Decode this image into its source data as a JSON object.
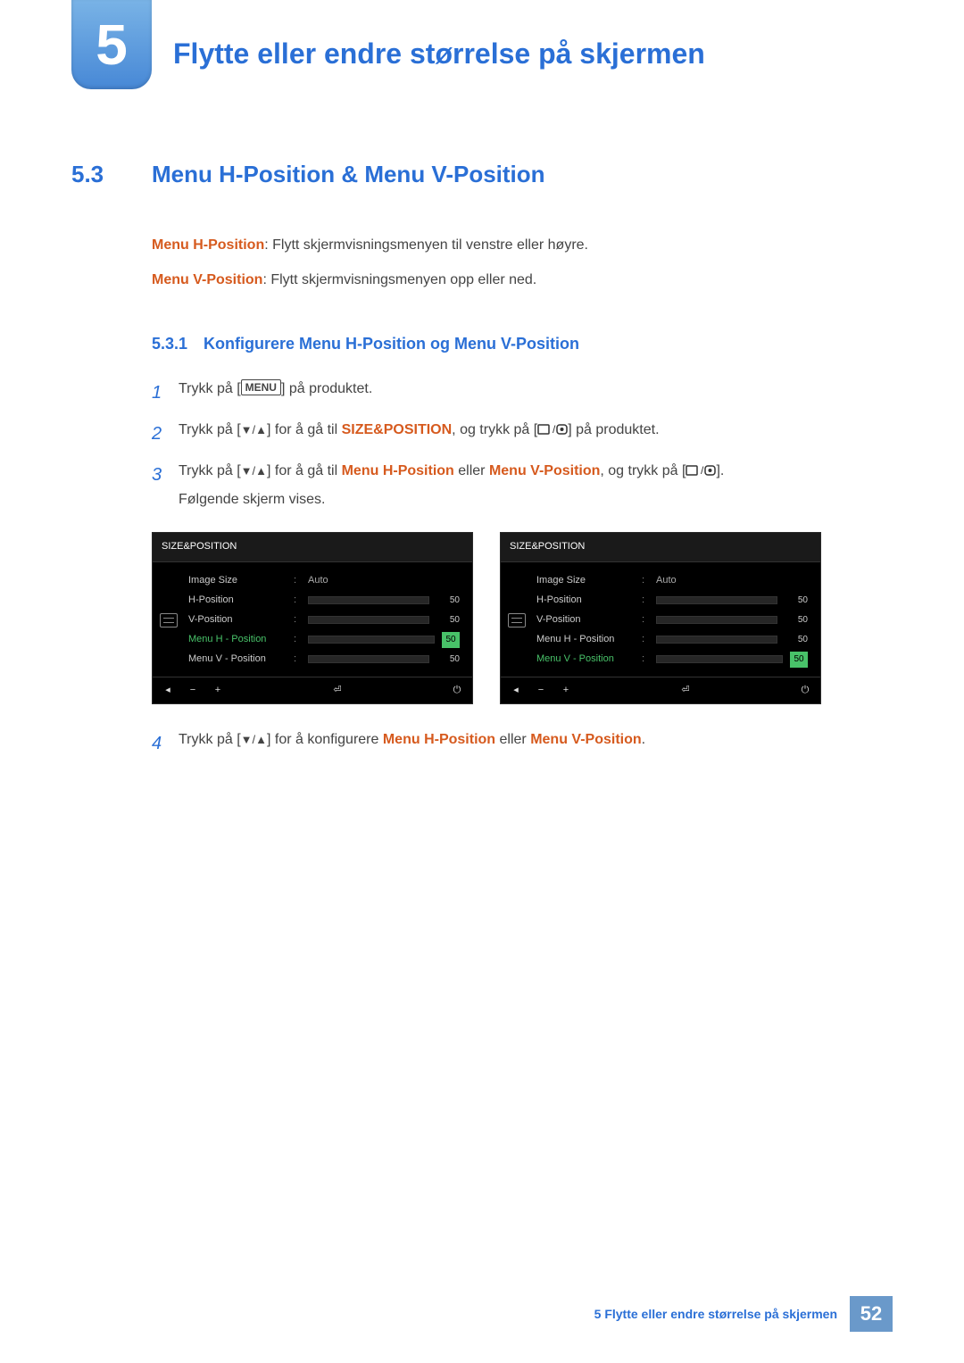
{
  "chapter": {
    "number": "5",
    "title": "Flytte eller endre størrelse på skjermen"
  },
  "section": {
    "number": "5.3",
    "title": "Menu H-Position & Menu V-Position"
  },
  "intro": {
    "hp_label": "Menu H-Position",
    "hp_text": ": Flytt skjermvisningsmenyen til venstre eller høyre.",
    "vp_label": "Menu V-Position",
    "vp_text": ": Flytt skjermvisningsmenyen opp eller ned."
  },
  "subsection": {
    "number": "5.3.1",
    "title": "Konfigurere Menu H-Position og Menu V-Position"
  },
  "steps": {
    "s1": {
      "num": "1",
      "a": "Trykk på [",
      "menu": "MENU",
      "b": "] på produktet."
    },
    "s2": {
      "num": "2",
      "a": "Trykk på [",
      "b": "] for å gå til ",
      "target": "SIZE&POSITION",
      "c": ", og trykk på [",
      "d": "] på produktet."
    },
    "s3": {
      "num": "3",
      "a": "Trykk på [",
      "b": "] for å gå til ",
      "t1": "Menu H-Position",
      "mid": " eller ",
      "t2": "Menu V-Position",
      "c": ", og trykk på [",
      "d": "].",
      "follow": "Følgende skjerm vises."
    },
    "s4": {
      "num": "4",
      "a": "Trykk på [",
      "b": "] for å konfigurere ",
      "t1": "Menu H-Position",
      "mid": " eller ",
      "t2": "Menu V-Position",
      "c": "."
    }
  },
  "osd": {
    "title": "SIZE&POSITION",
    "items": [
      {
        "label": "Image Size",
        "type": "text",
        "value": "Auto"
      },
      {
        "label": "H-Position",
        "type": "bar",
        "value": 50
      },
      {
        "label": "V-Position",
        "type": "bar",
        "value": 50
      },
      {
        "label": "Menu H - Position",
        "type": "bar",
        "value": 50
      },
      {
        "label": "Menu V - Position",
        "type": "bar",
        "value": 50
      }
    ],
    "left_selected_index": 3,
    "right_selected_index": 4,
    "footer_icons": [
      "◄",
      "−",
      "+",
      "↵",
      "⏻"
    ]
  },
  "footer": {
    "text": "5 Flytte eller endre størrelse på skjermen",
    "page": "52"
  }
}
